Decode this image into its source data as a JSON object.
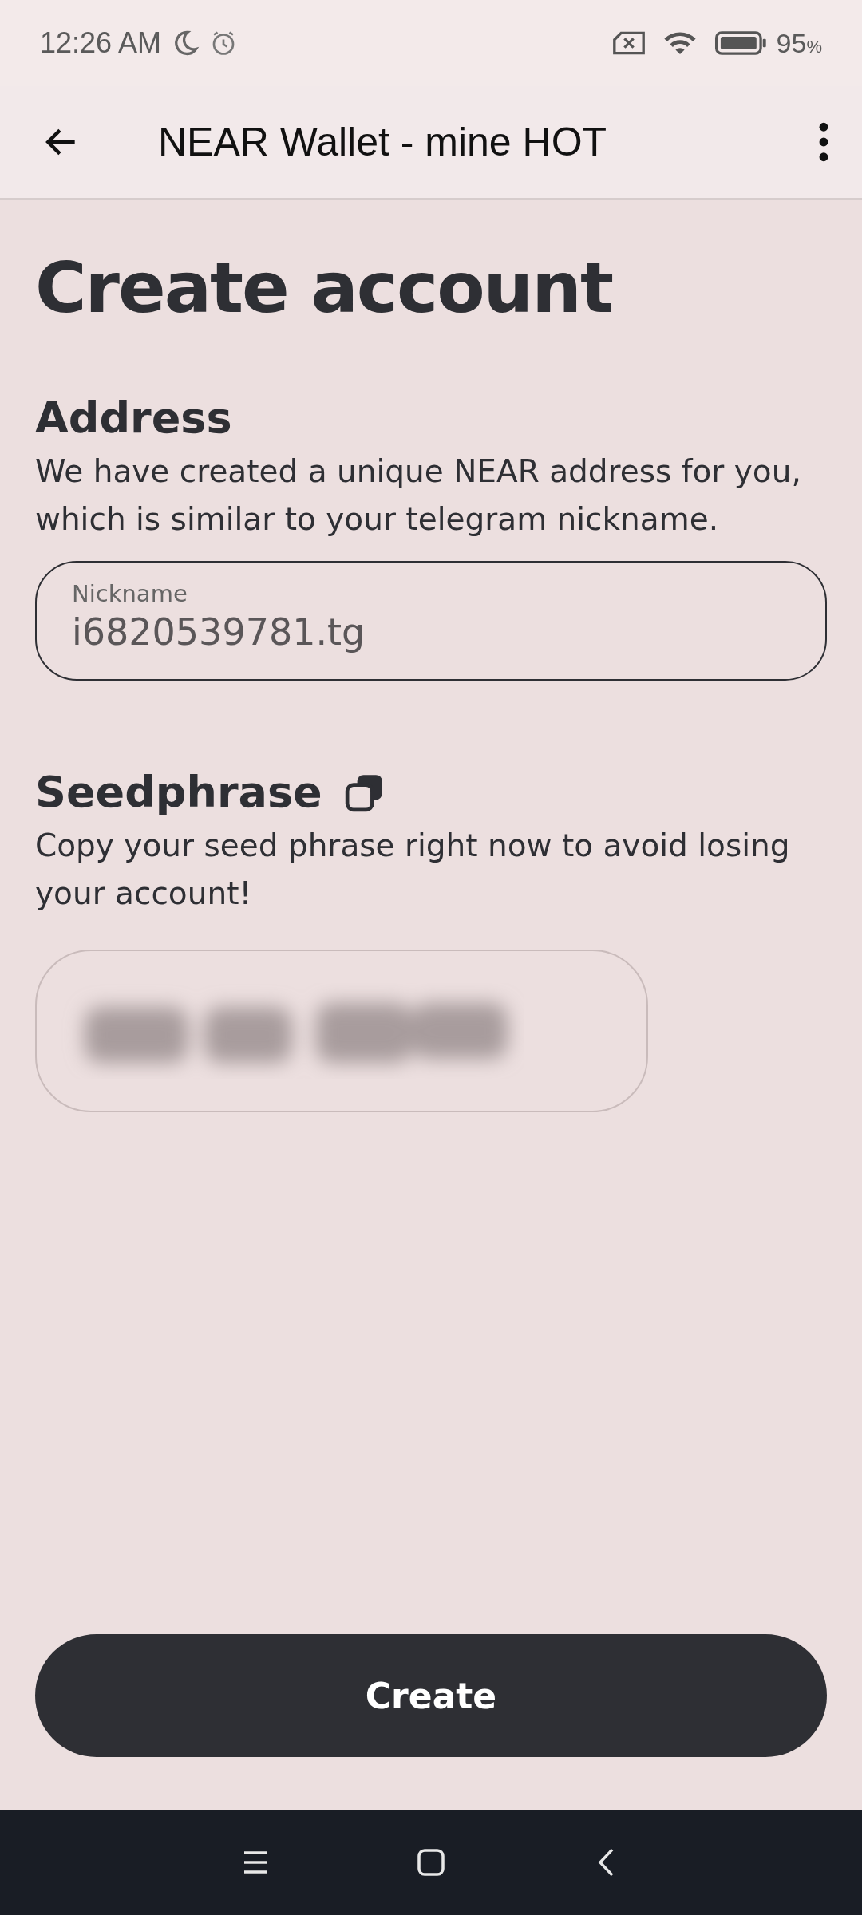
{
  "status_bar": {
    "time": "12:26 AM",
    "battery": "95",
    "battery_unit": "%"
  },
  "app_bar": {
    "title": "NEAR Wallet - mine HOT"
  },
  "page": {
    "title": "Create account"
  },
  "address": {
    "heading": "Address",
    "description": "We have created a unique NEAR address for you, which is similar to your telegram nickname.",
    "field": {
      "label": "Nickname",
      "value": "i6820539781.tg"
    }
  },
  "seedphrase": {
    "heading": "Seedphrase",
    "description": "Copy your seed phrase right now to avoid losing your account!"
  },
  "buttons": [
    {
      "label": "Create"
    }
  ]
}
